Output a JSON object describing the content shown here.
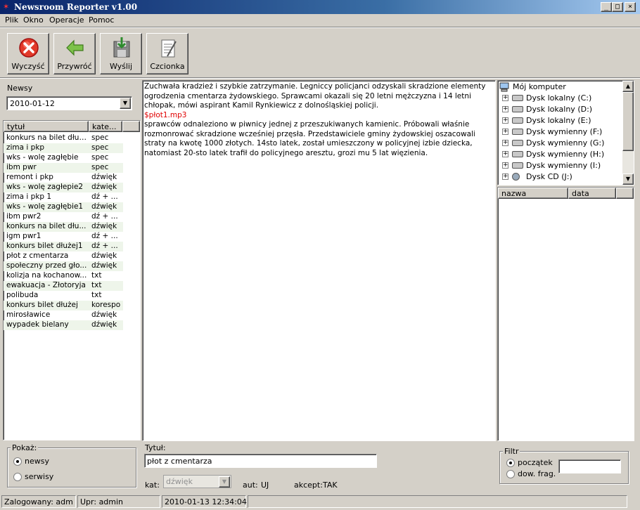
{
  "window": {
    "title": "Newsroom Reporter v1.00"
  },
  "menu": [
    "Plik",
    "Okno",
    "Operacje",
    "Pomoc"
  ],
  "toolbar": {
    "clear": "Wyczyść",
    "restore": "Przywróć",
    "send": "Wyślij",
    "font": "Czcionka"
  },
  "left": {
    "label": "Newsy",
    "date": "2010-01-12",
    "columns": [
      "tytuł",
      "kate..."
    ],
    "rows": [
      [
        "konkurs na bilet dłużej",
        "spec"
      ],
      [
        "zima i pkp",
        "spec"
      ],
      [
        "wks - wolę zagłębie",
        "spec"
      ],
      [
        "ibm pwr",
        "spec"
      ],
      [
        "remont i pkp",
        "dźwięk"
      ],
      [
        "wks - wolę zagłepie2",
        "dźwięk"
      ],
      [
        "zima i pkp 1",
        "dź + ..."
      ],
      [
        "wks - wolę zagłębie1",
        "dźwięk"
      ],
      [
        "ibm pwr2",
        "dź + ..."
      ],
      [
        "konkurs na bilet dłu...",
        "dźwięk"
      ],
      [
        "igm pwr1",
        "dź + ..."
      ],
      [
        "konkurs bilet dłużej1",
        "dź + ..."
      ],
      [
        "płot z cmentarza",
        "dźwięk"
      ],
      [
        "społeczny przed gło...",
        "dźwięk"
      ],
      [
        "kolizja na kochanow...",
        "txt"
      ],
      [
        "ewakuacja - Złotoryja",
        "txt"
      ],
      [
        "polibuda",
        "txt"
      ],
      [
        "konkurs bilet dłużej",
        "korespo"
      ],
      [
        "mirosławice",
        "dźwięk"
      ],
      [
        "wypadek bielany",
        "dźwięk"
      ]
    ]
  },
  "article": {
    "p1": "Zuchwała kradzież i szybkie zatrzymanie. Legniccy policjanci odzyskali skradzione elementy ogrodzenia cmentarza żydowskiego. Sprawcami okazali się 20 letni mężczyzna i 14 letni chłopak, mówi aspirant Kamil Rynkiewicz z dolnośląskiej policji.",
    "audio": "$płot1.mp3",
    "p2": "sprawców odnaleziono w piwnicy jednej z przeszukiwanych kamienic. Próbowali właśnie rozmonrować skradzione wcześniej przęsła. Przedstawiciele gminy żydowskiej oszacowali straty na kwotę 1000 złotych. 14sto latek, został umieszczony w policyjnej izbie dziecka, natomiast 20-sto latek trafił do policyjnego aresztu, grozi mu 5 lat więzienia."
  },
  "tree": {
    "root": "Mój komputer",
    "drives": [
      "Dysk lokalny (C:)",
      "Dysk lokalny (D:)",
      "Dysk lokalny (E:)",
      "Dysk wymienny (F:)",
      "Dysk wymienny (G:)",
      "Dysk wymienny (H:)",
      "Dysk wymienny (I:)",
      "Dysk CD (J:)"
    ]
  },
  "files": {
    "columns": [
      "nazwa",
      "data"
    ]
  },
  "show": {
    "title": "Pokaż:",
    "opt1": "newsy",
    "opt2": "serwisy",
    "selected": "newsy"
  },
  "detail": {
    "title_label": "Tytuł:",
    "title_value": "płot z cmentarza",
    "cat_label": "kat:",
    "cat_value": "dźwięk",
    "aut_label": "aut:",
    "aut_value": "UJ",
    "accept_label": "akcept:",
    "accept_value": "TAK"
  },
  "filter": {
    "title": "Filtr",
    "opt1": "początek",
    "opt2": "dow. frag.",
    "value": ""
  },
  "status": {
    "user": "Zalogowany: adm",
    "rights": "Upr: admin",
    "datetime": "2010-01-13 12:34:04"
  }
}
